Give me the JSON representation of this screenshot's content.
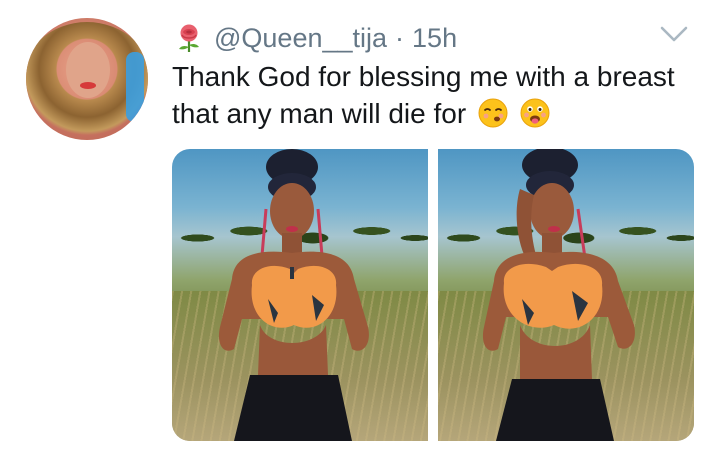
{
  "tweet": {
    "handle": "@Queen__tija",
    "separator": "·",
    "time": "15h",
    "text": "Thank God for blessing me with a breast that any man will die for",
    "emojis": [
      "hushed-face-emoji",
      "flushed-tongue-face-emoji"
    ]
  },
  "icons": {
    "avatar": "profile-avatar",
    "rose": "rose-icon",
    "more": "chevron-down-icon"
  },
  "colors": {
    "text": "#14171a",
    "secondary": "#657786",
    "chevron": "#aab8c2"
  },
  "media": {
    "count": 2
  }
}
